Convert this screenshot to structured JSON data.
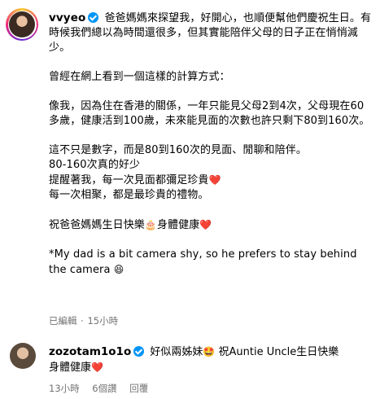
{
  "post": {
    "username": "vvyeo",
    "lines": [
      "爸爸媽媽來探望我，好開心，也順便幫他們慶祝生日。有時候我們總以為時間還很多，但其實能陪伴父母的日子正在悄悄減少。",
      "",
      "曾經在網上看到一個這樣的計算方式：",
      "",
      "像我，因為住在香港的關係，一年只能見父母2到4次，父母現在60多歲，健康活到100歲，未來能見面的次數也許只剩下80到160次。",
      "",
      "這不只是數字，而是80到160次的見面、閒聊和陪伴。",
      "80-160次真的好少",
      "提醒著我，每一次見面都彌足珍貴",
      "每一次相聚，都是最珍貴的禮物。",
      "",
      "祝爸爸媽媽生日快樂",
      "",
      "*My dad is a bit camera shy, so he prefers to stay behind the camera"
    ],
    "line_cake_emoji": "🎂",
    "line_after_cake": "身體健康",
    "heart_emoji": "❤️",
    "laugh_emoji": "😆",
    "edited_label": "已編輯",
    "time_label": "15小時"
  },
  "comment": {
    "username": "zozotam1o1o",
    "text_part1": "好似兩姊妹",
    "star_emoji": "🤩",
    "text_part2": "祝Auntie Uncle生日快樂",
    "text_line2": "身體健康",
    "heart_emoji": "❤️",
    "time": "13小時",
    "likes": "6個讚",
    "reply": "回覆"
  },
  "colors": {
    "verified": "#0095f6",
    "meta_gray": "#737373",
    "heart": "#e0245e"
  },
  "icons": [
    "verified-badge-icon",
    "avatar-image",
    "heart-emoji-icon",
    "cake-emoji-icon",
    "laugh-emoji-icon",
    "star-eyes-emoji-icon"
  ]
}
